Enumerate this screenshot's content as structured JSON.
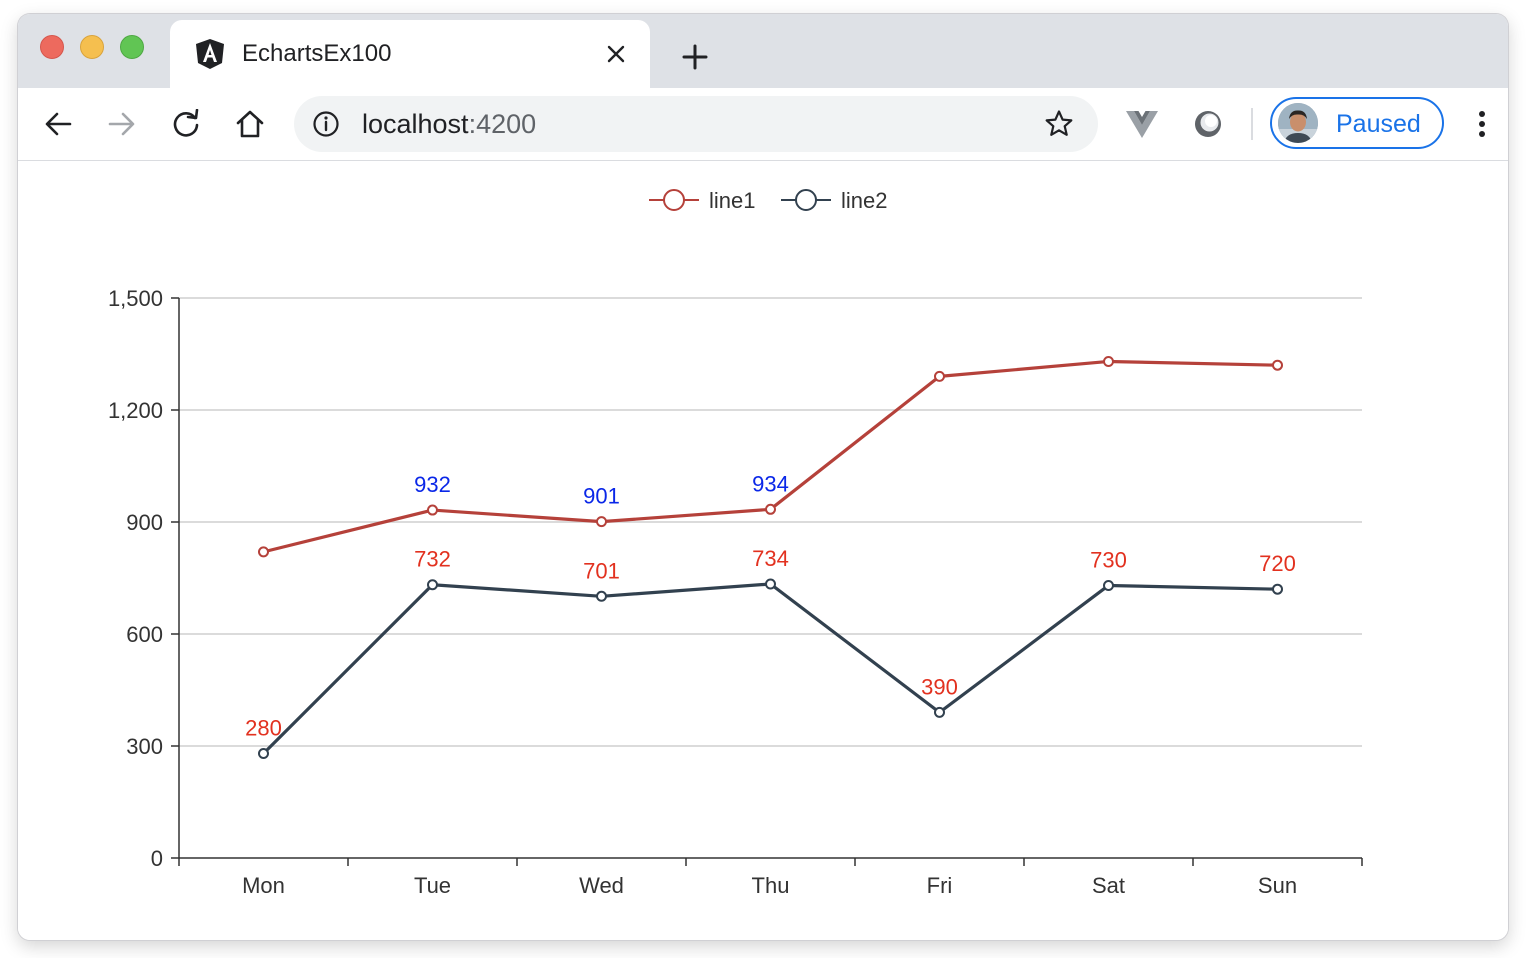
{
  "browser": {
    "tab_title": "EchartsEx100",
    "url_host": "localhost",
    "url_port": ":4200",
    "profile_label": "Paused"
  },
  "icons": {
    "tab": "angular-logo-icon",
    "close": "close-icon",
    "new_tab": "plus-icon",
    "back": "arrow-left-icon",
    "forward": "arrow-right-icon",
    "reload": "reload-icon",
    "home": "home-icon",
    "info": "info-icon",
    "bookmark": "star-icon",
    "extension1": "vue-devtools-icon",
    "extension2": "extension-icon",
    "menu": "kebab-menu-icon"
  },
  "chart_data": {
    "type": "line",
    "categories": [
      "Mon",
      "Tue",
      "Wed",
      "Thu",
      "Fri",
      "Sat",
      "Sun"
    ],
    "series": [
      {
        "name": "line1",
        "color": "#b5413a",
        "values": [
          820,
          932,
          901,
          934,
          1290,
          1330,
          1320
        ],
        "labels": [
          "",
          "932",
          "901",
          "934",
          "",
          "",
          ""
        ],
        "label_color": "#0a27e8"
      },
      {
        "name": "line2",
        "color": "#32414f",
        "values": [
          280,
          732,
          701,
          734,
          390,
          730,
          720
        ],
        "labels": [
          "280",
          "732",
          "701",
          "734",
          "390",
          "730",
          "720"
        ],
        "label_color": "#e2311f"
      }
    ],
    "yticks": [
      "0",
      "300",
      "600",
      "900",
      "1,200",
      "1,500"
    ],
    "ytick_values": [
      0,
      300,
      600,
      900,
      1200,
      1500
    ],
    "ylim": [
      0,
      1500
    ],
    "grid": true,
    "legend": "top-center"
  }
}
